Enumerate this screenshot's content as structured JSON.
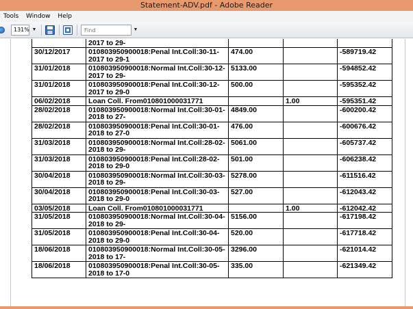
{
  "window": {
    "title": "Statement-ADV.pdf - Adobe Reader"
  },
  "menu": [
    "Tools",
    "Window",
    "Help"
  ],
  "toolbar": {
    "zoom": "131%",
    "find_placeholder": "Find"
  },
  "statement": {
    "partial_top": "2017 to 29-",
    "rows": [
      {
        "date": "30/12/2017",
        "desc": [
          "010803950900018:Penal Int.Coll:30-11-",
          "2017 to 29-1"
        ],
        "debit": "474.00",
        "credit": "",
        "balance": "-589719.42"
      },
      {
        "date": "31/01/2018",
        "desc": [
          "010803950900018:Normal Int.Coll:30-12-",
          "2017 to 29-"
        ],
        "debit": "5133.00",
        "credit": "",
        "balance": "-594852.42"
      },
      {
        "date": "31/01/2018",
        "desc": [
          "010803950900018:Penal Int.Coll:30-12-",
          "2017 to 29-0"
        ],
        "debit": "500.00",
        "credit": "",
        "balance": "-595352.42"
      },
      {
        "date": "06/02/2018",
        "desc": [
          "Loan Coll. From010801000031771"
        ],
        "debit": "",
        "credit": "1.00",
        "balance": "-595351.42"
      },
      {
        "date": "28/02/2018",
        "desc": [
          "010803950900018:Normal Int.Coll:30-01-",
          "2018 to 27-"
        ],
        "debit": "4849.00",
        "credit": "",
        "balance": "-600200.42"
      },
      {
        "date": "28/02/2018",
        "desc": [
          "010803950900018:Penal Int.Coll:30-01-",
          "2018 to 27-0"
        ],
        "debit": "476.00",
        "credit": "",
        "balance": "-600676.42"
      },
      {
        "date": "31/03/2018",
        "desc": [
          "010803950900018:Normal Int.Coll:28-02-",
          "2018 to 29-"
        ],
        "debit": "5061.00",
        "credit": "",
        "balance": "-605737.42"
      },
      {
        "date": "31/03/2018",
        "desc": [
          "010803950900018:Penal Int.Coll:28-02-",
          "2018 to 29-0"
        ],
        "debit": "501.00",
        "credit": "",
        "balance": "-606238.42"
      },
      {
        "date": "30/04/2018",
        "desc": [
          "010803950900018:Normal Int.Coll:30-03-",
          "2018 to 29-"
        ],
        "debit": "5278.00",
        "credit": "",
        "balance": "-611516.42"
      },
      {
        "date": "30/04/2018",
        "desc": [
          "010803950900018:Penal Int.Coll:30-03-",
          "2018 to 29-0"
        ],
        "debit": "527.00",
        "credit": "",
        "balance": "-612043.42"
      },
      {
        "date": "03/05/2018",
        "desc": [
          "Loan Coll. From010801000031771"
        ],
        "debit": "",
        "credit": "1.00",
        "balance": "-612042.42"
      },
      {
        "date": "31/05/2018",
        "desc": [
          "010803950900018:Normal Int.Coll:30-04-",
          "2018 to 29-"
        ],
        "debit": "5156.00",
        "credit": "",
        "balance": "-617198.42"
      },
      {
        "date": "31/05/2018",
        "desc": [
          "010803950900018:Penal Int.Coll:30-04-",
          "2018 to 29-0"
        ],
        "debit": "520.00",
        "credit": "",
        "balance": "-617718.42"
      },
      {
        "date": "18/06/2018",
        "desc": [
          "010803950900018:Normal Int.Coll:30-05-",
          "2018 to 17-"
        ],
        "debit": "3296.00",
        "credit": "",
        "balance": "-621014.42"
      },
      {
        "date": "18/06/2018",
        "desc": [
          "010803950900018:Penal Int.Coll:30-05-",
          "2018 to 17-0"
        ],
        "debit": "335.00",
        "credit": "",
        "balance": "-621349.42"
      }
    ]
  }
}
